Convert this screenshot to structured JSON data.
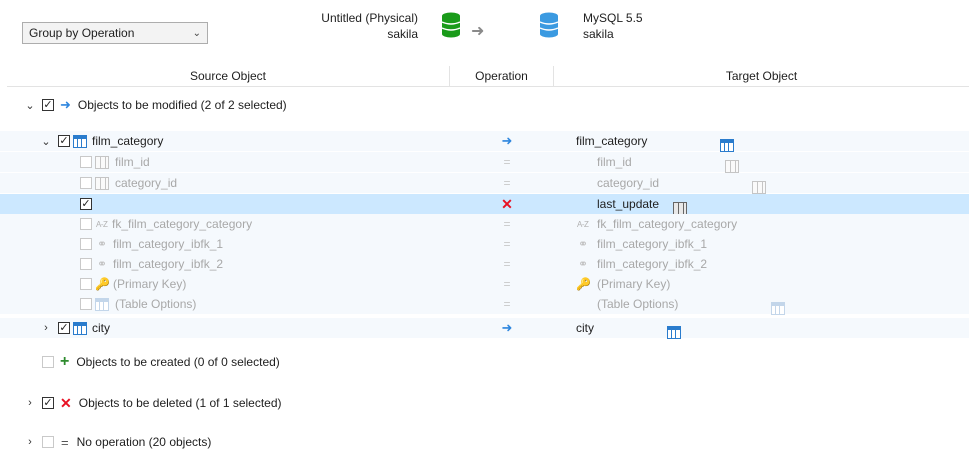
{
  "toolbar": {
    "group_by": "Group by Operation"
  },
  "source": {
    "name": "Untitled (Physical)",
    "schema": "sakila",
    "db_color": "#1a9b1a"
  },
  "target": {
    "name": "MySQL 5.5",
    "schema": "sakila",
    "db_color": "#3b9ae1"
  },
  "columns": {
    "source": "Source Object",
    "operation": "Operation",
    "target": "Target Object"
  },
  "groups": {
    "modified": "Objects to be modified (2 of 2 selected)",
    "created": "Objects to be created (0 of 0 selected)",
    "deleted": "Objects to be deleted (1 of 1 selected)",
    "noop": "No operation (20 objects)"
  },
  "film_category": {
    "source": "film_category",
    "target": "film_category",
    "children": [
      {
        "source": "film_id",
        "target": "film_id"
      },
      {
        "source": "category_id",
        "target": "category_id"
      },
      {
        "source": "",
        "target": "last_update"
      },
      {
        "source": "fk_film_category_category",
        "target": "fk_film_category_category"
      },
      {
        "source": "film_category_ibfk_1",
        "target": "film_category_ibfk_1"
      },
      {
        "source": "film_category_ibfk_2",
        "target": "film_category_ibfk_2"
      },
      {
        "source": "(Primary Key)",
        "target": "(Primary Key)"
      },
      {
        "source": "(Table Options)",
        "target": "(Table Options)"
      }
    ]
  },
  "city": {
    "source": "city",
    "target": "city"
  },
  "icons": {
    "az": "A-Z"
  }
}
